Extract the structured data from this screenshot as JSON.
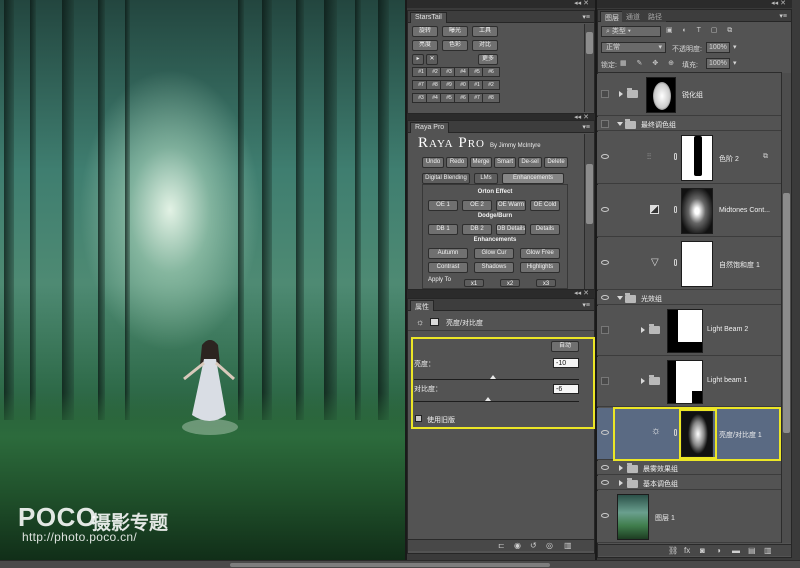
{
  "photo": {
    "brand": "POCO",
    "brand_sub": "摄影专题",
    "url": "http://photo.poco.cn/"
  },
  "starstail": {
    "title": "StarsTail",
    "row1": [
      "旋转",
      "曝光",
      "工具"
    ],
    "row2": [
      "亮度",
      "色彩",
      "对比"
    ],
    "more": "更多",
    "play_icon": "play-icon",
    "close_icon": "close-icon",
    "grid": [
      [
        "#1",
        "#2",
        "#3",
        "#4",
        "#5",
        "#6"
      ],
      [
        "#7",
        "#8",
        "#9",
        "#0",
        "#1",
        "#2"
      ],
      [
        "#3",
        "#4",
        "#5",
        "#6",
        "#7",
        "#8"
      ]
    ]
  },
  "raya": {
    "tab": "Raya Pro",
    "logo": "Raya Pro",
    "byline": "By Jimmy McIntyre",
    "actions": [
      "Undo",
      "Redo",
      "Merge",
      "Smart",
      "De-sel",
      "Delete"
    ],
    "tabs": [
      "Digital Blending",
      "LMs",
      "Enhancements"
    ],
    "orton_title": "Orton Effect",
    "orton": [
      "OE 1",
      "OE 2",
      "OE Warm",
      "OE Cold"
    ],
    "dodge_title": "Dodge/Burn",
    "dodge": [
      "DB 1",
      "DB 2",
      "DB Details",
      "Details"
    ],
    "enh_title": "Enhancements",
    "enh_row1": [
      "Autumn",
      "Glow Cur",
      "Glow Free"
    ],
    "enh_row2": [
      "Contrast",
      "Shadows",
      "Highlights"
    ],
    "apply": "Apply To",
    "apply_opts": [
      "x1",
      "x2",
      "x3"
    ]
  },
  "properties": {
    "tab": "属性",
    "layer_label": "亮度/对比度",
    "auto_button": "自动",
    "brightness_label": "亮度：",
    "brightness_value": "-10",
    "contrast_label": "对比度：",
    "contrast_value": "-6",
    "legacy_label": "使用旧版"
  },
  "layers": {
    "tabs": [
      "图层",
      "通道",
      "路径"
    ],
    "filter_label": "类型",
    "blend_mode": "正常",
    "opacity_label": "不透明度:",
    "opacity_value": "100%",
    "lock_label": "锁定:",
    "fill_label": "填充:",
    "fill_value": "100%",
    "rows": [
      {
        "name": "锐化组"
      },
      {
        "name": "最终调色组"
      },
      {
        "name": "色阶 2"
      },
      {
        "name": "Midtones Cont..."
      },
      {
        "name": "自然饱和度 1"
      },
      {
        "name": "光效组"
      },
      {
        "name": "Light Beam 2"
      },
      {
        "name": "Light beam 1"
      },
      {
        "name": "亮度/对比度 1"
      },
      {
        "name": "晨雾效果组"
      },
      {
        "name": "基本调色组"
      },
      {
        "name": "图层 1"
      }
    ],
    "bottom_icons": [
      "link-icon",
      "fx-icon",
      "mask-icon",
      "adjustment-icon",
      "group-icon",
      "new-layer-icon",
      "trash-icon"
    ]
  },
  "colors": {
    "highlight": "#ece626",
    "selected_row": "#5a6a83"
  }
}
